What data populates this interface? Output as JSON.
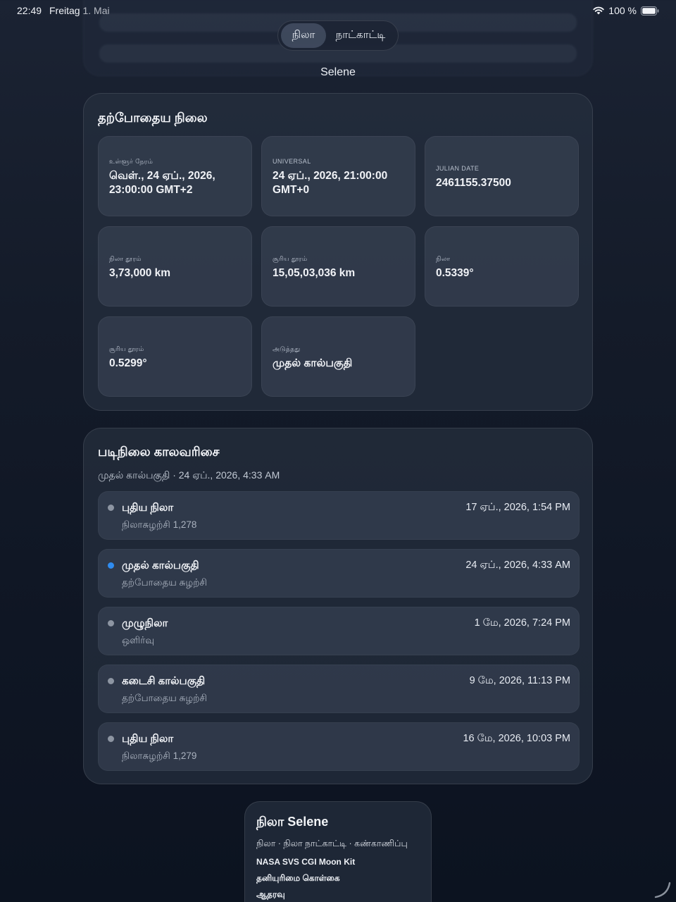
{
  "status": {
    "time": "22:49",
    "date": "Freitag 1. Mai",
    "battery": "100 %"
  },
  "tabs": [
    {
      "label": "நிலா",
      "active": true
    },
    {
      "label": "நாட்காட்டி",
      "active": false
    }
  ],
  "app_title": "Selene",
  "current": {
    "title": "தற்போதைய நிலை",
    "tiles": [
      {
        "label": "உள்ளூர் நேரம்",
        "value": "வெள்., 24 ஏப்., 2026, 23:00:00 GMT+2"
      },
      {
        "label": "UNIVERSAL",
        "value": "24 ஏப்., 2026, 21:00:00 GMT+0"
      },
      {
        "label": "JULIAN DATE",
        "value": "2461155.37500"
      },
      {
        "label": "நிலா தூரம்",
        "value": "3,73,000 km"
      },
      {
        "label": "சூரிய தூரம்",
        "value": "15,05,03,036 km"
      },
      {
        "label": "நிலா",
        "value": "0.5339°"
      },
      {
        "label": "சூரிய தூரம்",
        "value": "0.5299°"
      },
      {
        "label": "அடுத்தது",
        "value": "முதல் கால்பகுதி"
      }
    ]
  },
  "timeline": {
    "title": "படிநிலை காலவரிசை",
    "subtitle": "முதல் கால்பகுதி · 24 ஏப்., 2026, 4:33 AM",
    "rows": [
      {
        "name": "புதிய நிலா",
        "sub": "நிலாசுழற்சி 1,278",
        "date": "17 ஏப்., 2026, 1:54 PM",
        "current": false
      },
      {
        "name": "முதல் கால்பகுதி",
        "sub": "தற்போதைய சுழற்சி",
        "date": "24 ஏப்., 2026, 4:33 AM",
        "current": true
      },
      {
        "name": "முழுநிலா",
        "sub": "ஒளிர்வு",
        "date": "1 மே, 2026, 7:24 PM",
        "current": false
      },
      {
        "name": "கடைசி கால்பகுதி",
        "sub": "தற்போதைய சுழற்சி",
        "date": "9 மே, 2026, 11:13 PM",
        "current": false
      },
      {
        "name": "புதிய நிலா",
        "sub": "நிலாசுழற்சி 1,279",
        "date": "16 மே, 2026, 10:03 PM",
        "current": false
      }
    ]
  },
  "footer": {
    "title": "நிலா Selene",
    "nav": "நிலா · நிலா நாட்காட்டி · கண்காணிப்பு",
    "links": [
      "NASA SVS CGI Moon Kit",
      "தனியுரிமை கொள்கை",
      "ஆதரவு"
    ]
  },
  "colors": {
    "accent": "#2f8cf0",
    "background": "#141b29",
    "card": "#262f3f"
  }
}
